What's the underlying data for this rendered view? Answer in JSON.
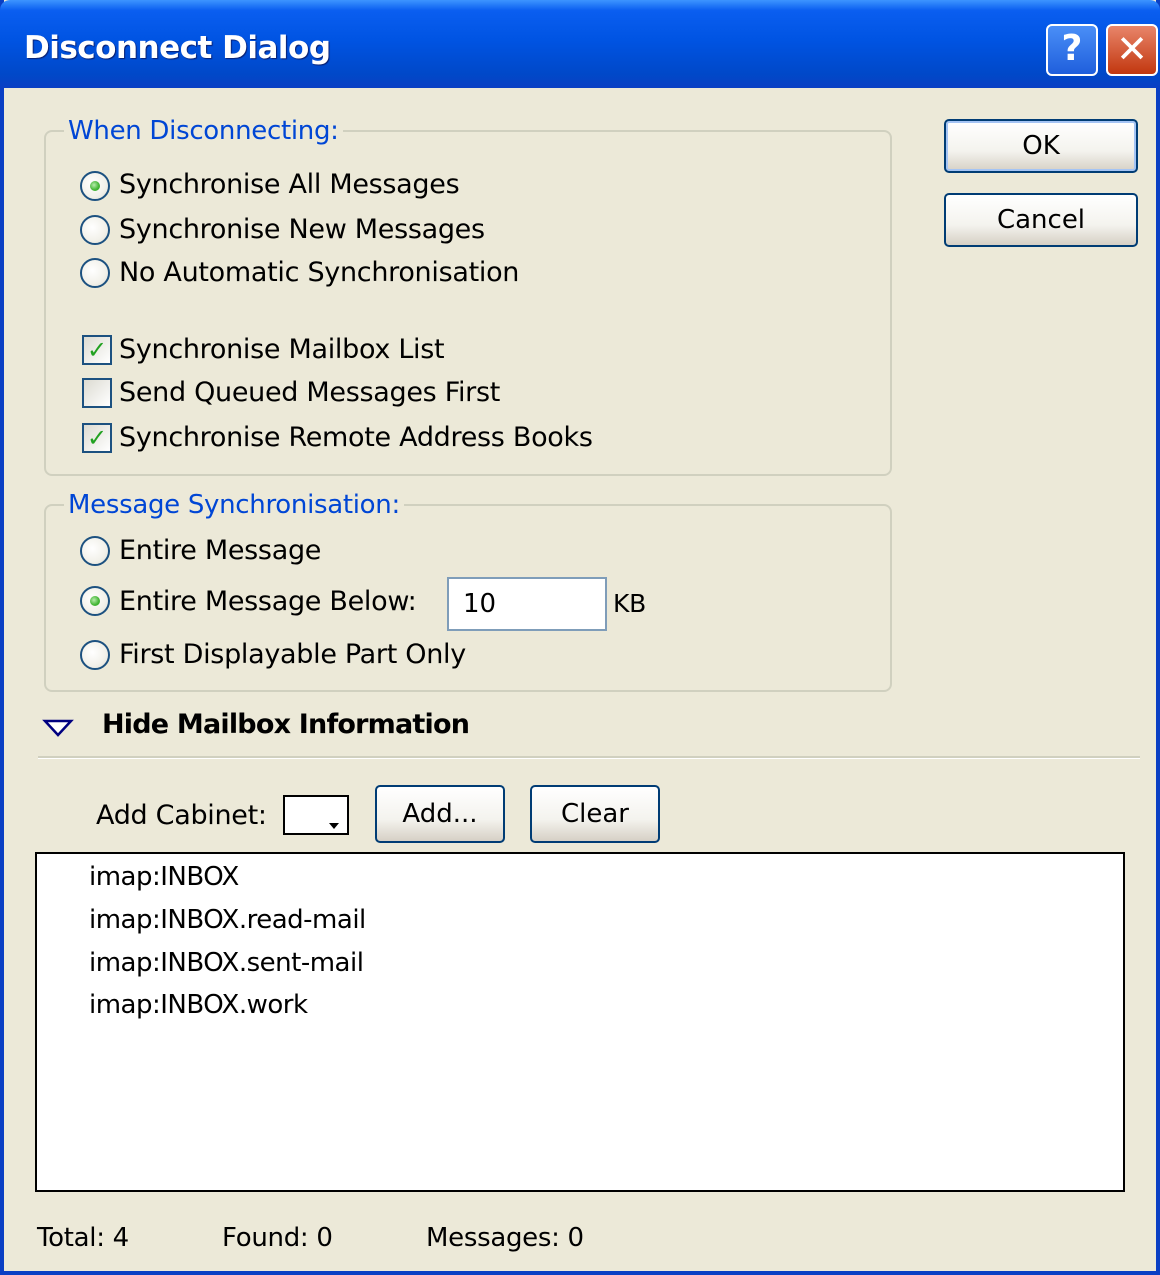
{
  "window": {
    "title": "Disconnect Dialog",
    "help_glyph": "?",
    "close_glyph": "✕"
  },
  "buttons": {
    "ok": "OK",
    "cancel": "Cancel",
    "add": "Add...",
    "clear": "Clear"
  },
  "when_disconnecting": {
    "legend": "When Disconnecting:",
    "radios": [
      {
        "label": "Synchronise All Messages",
        "checked": true
      },
      {
        "label": "Synchronise New Messages",
        "checked": false
      },
      {
        "label": "No Automatic Synchronisation",
        "checked": false
      }
    ],
    "checkboxes": [
      {
        "label": "Synchronise Mailbox List",
        "checked": true
      },
      {
        "label": "Send Queued Messages First",
        "checked": false
      },
      {
        "label": "Synchronise Remote Address Books",
        "checked": true
      }
    ]
  },
  "message_sync": {
    "legend": "Message Synchronisation:",
    "radios": [
      {
        "label": "Entire Message",
        "checked": false
      },
      {
        "label": "Entire Message Below:",
        "checked": true
      },
      {
        "label": "First Displayable Part Only",
        "checked": false
      }
    ],
    "size_value": "10",
    "size_unit": "KB"
  },
  "mailbox_info": {
    "toggle_label": "Hide Mailbox Information",
    "add_cabinet_label": "Add Cabinet:",
    "mailboxes": [
      "imap:INBOX",
      "imap:INBOX.read-mail",
      "imap:INBOX.sent-mail",
      "imap:INBOX.work"
    ]
  },
  "status": {
    "total": "Total: 4",
    "found": "Found: 0",
    "messages": "Messages: 0"
  },
  "colors": {
    "title_bar": "#0054e3",
    "group_legend": "#0046d5",
    "dialog_bg": "#ece9d8",
    "check_mark": "#21a121"
  }
}
